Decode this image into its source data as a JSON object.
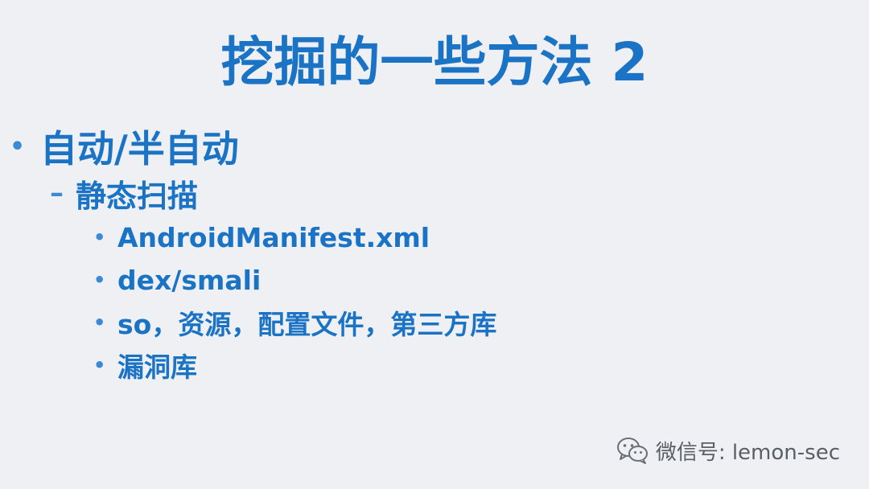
{
  "slide": {
    "title": "挖掘的一些方法 2",
    "bullets": [
      {
        "marker": "•",
        "text": "自动/半自动"
      },
      {
        "marker": "–",
        "text": "静态扫描"
      }
    ],
    "sub_bullets": [
      {
        "marker": "•",
        "text": "AndroidManifest.xml"
      },
      {
        "marker": "•",
        "text": "dex/smali"
      },
      {
        "marker": "•",
        "text": "so，资源，配置文件，第三方库"
      },
      {
        "marker": "•",
        "text": "漏洞库"
      }
    ]
  },
  "watermark": {
    "icon": "wechat-icon",
    "text": "微信号: lemon-sec"
  },
  "colors": {
    "background": "#eef0f3",
    "text": "#1a73c4",
    "bullet": "#3b8bd4",
    "watermark": "#5a5e66"
  }
}
